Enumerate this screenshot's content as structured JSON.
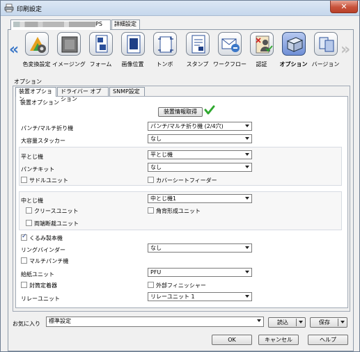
{
  "window": {
    "title": "印刷設定",
    "close_label": "✕"
  },
  "top_tabs": {
    "model_suffix": "PS",
    "detail": "詳細設定"
  },
  "icon_bar": [
    {
      "label": "色変換設定",
      "icon": "color-conversion-icon"
    },
    {
      "label": "イメージング",
      "icon": "imaging-icon"
    },
    {
      "label": "フォーム",
      "icon": "form-icon"
    },
    {
      "label": "画像位置",
      "icon": "image-position-icon"
    },
    {
      "label": "トンボ",
      "icon": "crop-marks-icon"
    },
    {
      "label": "スタンプ",
      "icon": "stamp-icon"
    },
    {
      "label": "ワークフロー",
      "icon": "workflow-icon"
    },
    {
      "label": "認証",
      "icon": "authentication-icon"
    },
    {
      "label": "オプション",
      "icon": "options-icon",
      "selected": true
    },
    {
      "label": "バージョン",
      "icon": "version-icon"
    }
  ],
  "section_label": "オプション",
  "sub_tabs": [
    "装置オプション",
    "ドライバー オプション",
    "SNMP設定"
  ],
  "group_legend": "装置オプション",
  "get_device_info_button": "装置情報取得",
  "fields": {
    "punch": {
      "label": "パンチ/マルチ折り機",
      "value": "パンチ/マルチ折り機 (2/4穴)"
    },
    "stacker": {
      "label": "大容量スタッカー",
      "value": "なし"
    },
    "flat_binding": {
      "label": "平とじ機",
      "value": "平とじ機"
    },
    "punch_kit": {
      "label": "パンチキット",
      "value": "なし"
    },
    "saddle_unit": {
      "label": "サドルユニット",
      "checked": false
    },
    "cover_sheet_feeder": {
      "label": "カバーシートフィーダー",
      "checked": false
    },
    "saddle_binding": {
      "label": "中とじ機",
      "value": "中とじ機1"
    },
    "crease_unit": {
      "label": "クリースユニット",
      "checked": false
    },
    "square_fold_unit": {
      "label": "角背形成ユニット",
      "checked": false
    },
    "trim_unit": {
      "label": "両端断裁ユニット",
      "checked": false
    },
    "perfect_binder": {
      "label": "くるみ製本機",
      "checked": true
    },
    "ring_binder": {
      "label": "リングバインダー",
      "value": "なし"
    },
    "multi_punch": {
      "label": "マルチパンチ機",
      "checked": false
    },
    "paper_feed_unit": {
      "label": "給紙ユニット",
      "value": "PFU"
    },
    "envelope_fuser": {
      "label": "封筒定着器",
      "checked": false
    },
    "external_finisher": {
      "label": "外部フィニッシャー",
      "checked": false
    },
    "relay_unit": {
      "label": "リレーユニット",
      "value": "リレーユニット 1"
    }
  },
  "footer": {
    "favorites_label": "お気に入り",
    "favorites_value": "標準設定",
    "load_button": "読込",
    "save_button": "保存",
    "ok_button": "OK",
    "cancel_button": "キャンセル",
    "help_button": "ヘルプ"
  },
  "colors": {
    "accent": "#3c78c8",
    "check_green": "#2fa82f",
    "selected_icon": "#6f8fd6"
  }
}
